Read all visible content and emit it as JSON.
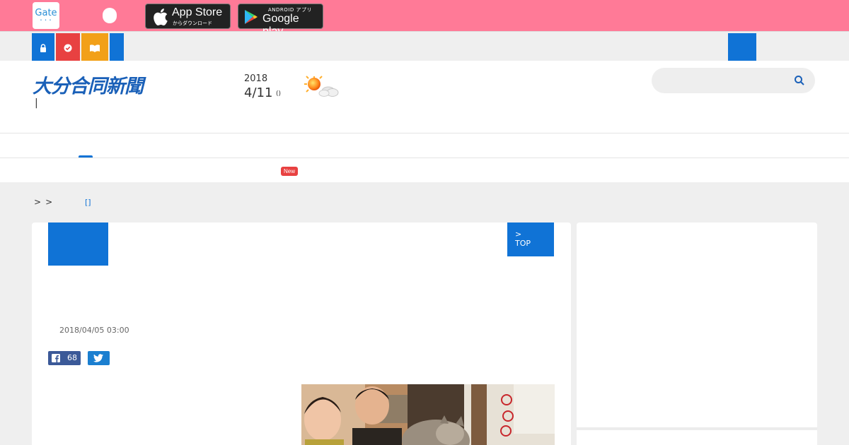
{
  "topbar": {
    "gate_label": "Gate",
    "gate_dots": "• • •",
    "appstore": {
      "title": "App Store",
      "subtitle": "からダウンロード"
    },
    "googleplay": {
      "subtitle": "ANDROID アプリ",
      "title": "Google play"
    }
  },
  "iconstrip": {
    "icons": [
      "lock-icon",
      "check-icon",
      "book-icon"
    ]
  },
  "header": {
    "logo": "大分合同新聞",
    "logo_sub": "|",
    "year": "2018",
    "day": "4/11",
    "weekday": "()",
    "weather_icon": "sunny-cloudy-icon",
    "search_placeholder": ""
  },
  "nav": {
    "new_badge": "New"
  },
  "breadcrumb": {
    "sep1": ">",
    "sep2": ">",
    "link": "[]"
  },
  "article": {
    "top_button_line1": ">",
    "top_button_line2": "TOP",
    "date": "2018/04/05 03:00",
    "facebook_count": "68"
  },
  "colors": {
    "topbar": "#ff7a97",
    "accent_blue": "#1073d6",
    "red": "#e84141",
    "orange": "#f2a018",
    "facebook": "#3b5998"
  }
}
